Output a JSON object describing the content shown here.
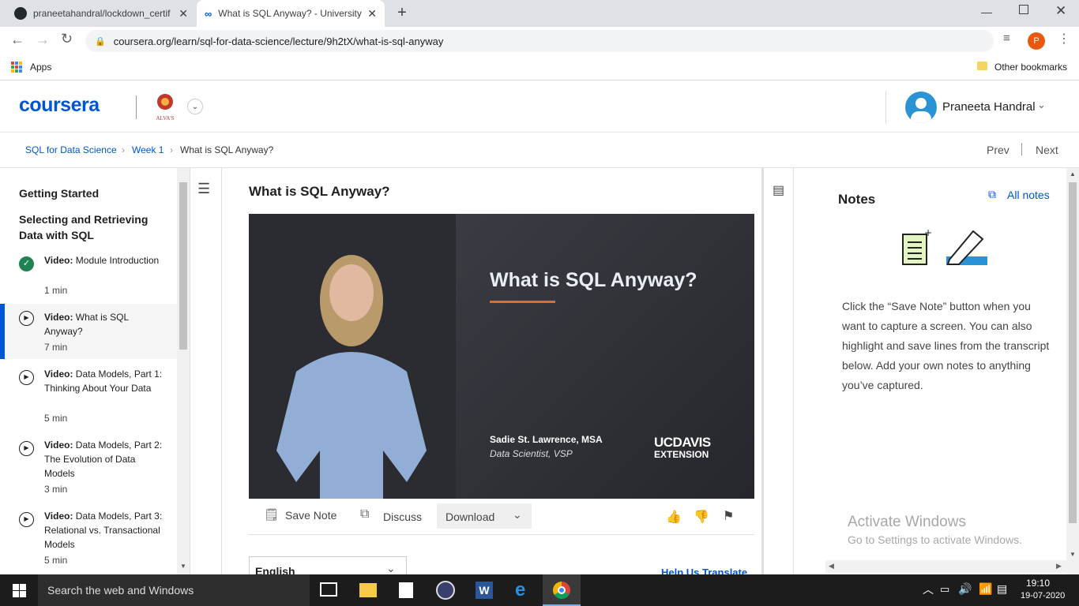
{
  "browser": {
    "tabs": [
      {
        "title": "praneetahandral/lockdown_certif"
      },
      {
        "title": "What is SQL Anyway? - University"
      }
    ],
    "url": "coursera.org/learn/sql-for-data-science/lecture/9h2tX/what-is-sql-anyway",
    "profile_initial": "P",
    "bookmarks": {
      "apps": "Apps",
      "other": "Other bookmarks"
    }
  },
  "header": {
    "logo": "coursera",
    "partner": "ALVA'S",
    "user_name": "Praneeta Handral"
  },
  "breadcrumb": {
    "course": "SQL for Data Science",
    "week": "Week 1",
    "current": "What is SQL Anyway?",
    "prev": "Prev",
    "next": "Next"
  },
  "sidebar": {
    "section1": "Getting Started",
    "section2": "Selecting and Retrieving Data with SQL",
    "items": [
      {
        "kind": "Video:",
        "title": "Module Introduction",
        "duration": "1 min"
      },
      {
        "kind": "Video:",
        "title": "What is SQL Anyway?",
        "duration": "7 min"
      },
      {
        "kind": "Video:",
        "title": "Data Models, Part 1: Thinking About Your Data",
        "duration": "5 min"
      },
      {
        "kind": "Video:",
        "title": "Data Models, Part 2: The Evolution of Data Models",
        "duration": "3 min"
      },
      {
        "kind": "Video:",
        "title": "Data Models, Part 3: Relational vs. Transactional Models",
        "duration": "5 min"
      }
    ]
  },
  "lecture": {
    "title": "What is SQL Anyway?",
    "video_title": "What is SQL Anyway?",
    "presenter": "Sadie St. Lawrence, MSA",
    "presenter_role": "Data Scientist, VSP",
    "brand_line1": "UCDAVIS",
    "brand_line2": "EXTENSION",
    "save_note": "Save Note",
    "discuss": "Discuss",
    "download": "Download",
    "language": "English",
    "help_translate": "Help Us Translate"
  },
  "notes": {
    "heading": "Notes",
    "all_notes": "All notes",
    "description": "Click the “Save Note” button when you want to capture a screen. You can also highlight and save lines from the transcript below. Add your own notes to anything you’ve captured.",
    "watermark_title": "Activate Windows",
    "watermark_sub": "Go to Settings to activate Windows."
  },
  "taskbar": {
    "search": "Search the web and Windows",
    "time": "19:10",
    "date": "19-07-2020"
  },
  "colors": {
    "accent": "#0056d2",
    "complete": "#1f8354",
    "active_bar": "#0056d2"
  }
}
